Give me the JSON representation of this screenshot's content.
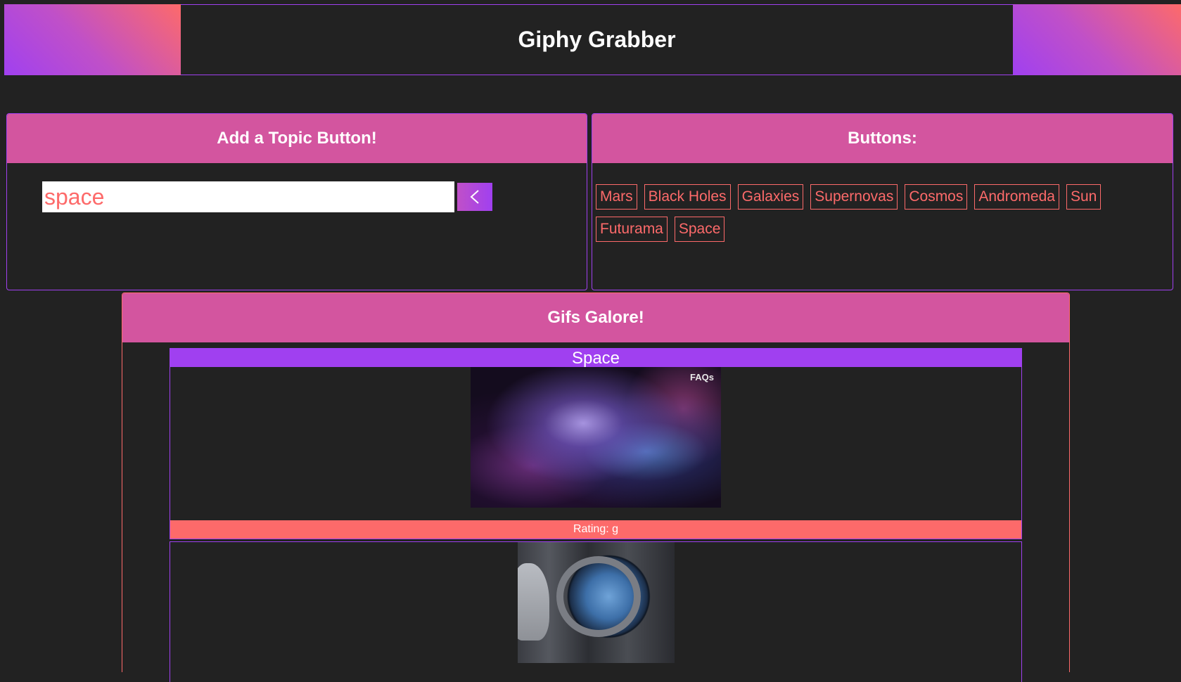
{
  "header": {
    "title": "Giphy Grabber"
  },
  "add_panel": {
    "heading": "Add a Topic Button!",
    "input_value": "space",
    "submit_icon": "chevron-left-icon"
  },
  "buttons_panel": {
    "heading": "Buttons:",
    "topics": [
      "Mars",
      "Black Holes",
      "Galaxies",
      "Supernovas",
      "Cosmos",
      "Andromeda",
      "Sun",
      "Futurama",
      "Space"
    ]
  },
  "gifs_panel": {
    "heading": "Gifs Galore!",
    "cards": [
      {
        "title": "Space",
        "image": "nebula-gif",
        "overlay_text": "FAQs",
        "rating": "Rating: g"
      },
      {
        "image": "astronaut-window-gif"
      }
    ]
  },
  "colors": {
    "background": "#222222",
    "panel_header": "#d3559f",
    "purple": "#a040f0",
    "coral": "#fd6a6a"
  }
}
